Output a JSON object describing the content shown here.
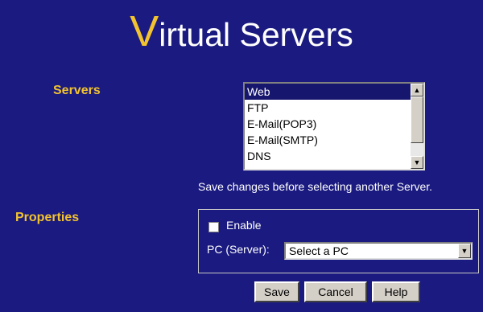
{
  "title": {
    "first_letter": "V",
    "rest": "irtual Servers"
  },
  "servers": {
    "label": "Servers",
    "items": [
      "Web",
      "FTP",
      "E-Mail(POP3)",
      "E-Mail(SMTP)",
      "DNS"
    ],
    "selected_index": 0,
    "note": "Save changes before selecting another Server."
  },
  "properties": {
    "label": "Properties",
    "enable_label": "Enable",
    "enable_checked": false,
    "pc_label": "PC (Server):",
    "pc_value": "Select a PC"
  },
  "buttons": {
    "save": "Save",
    "cancel": "Cancel",
    "help": "Help"
  },
  "icons": {
    "scroll_up": "scroll-up-arrow-icon",
    "scroll_down": "scroll-down-arrow-icon",
    "dropdown": "dropdown-arrow-icon"
  },
  "colors": {
    "background": "#1a1a80",
    "accent": "#f2c32f",
    "selection": "#16166e"
  }
}
